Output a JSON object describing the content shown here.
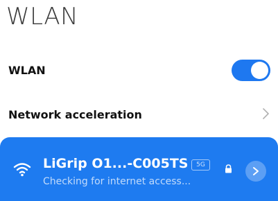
{
  "header": {
    "title": "WLAN"
  },
  "wlan_toggle": {
    "label": "WLAN",
    "enabled": true
  },
  "network_acceleration": {
    "label": "Network acceleration",
    "icon": "chevron-right-icon"
  },
  "connected_network": {
    "name": "LiGrip O1...-C005TS",
    "band_badge": "5G",
    "status": "Checking for internet access...",
    "secured": true,
    "icons": [
      "wifi-icon",
      "lock-icon",
      "chevron-right-icon"
    ]
  },
  "colors": {
    "accent": "#1e78f0",
    "title_text": "#3a3a3a",
    "label_text": "#111111"
  }
}
